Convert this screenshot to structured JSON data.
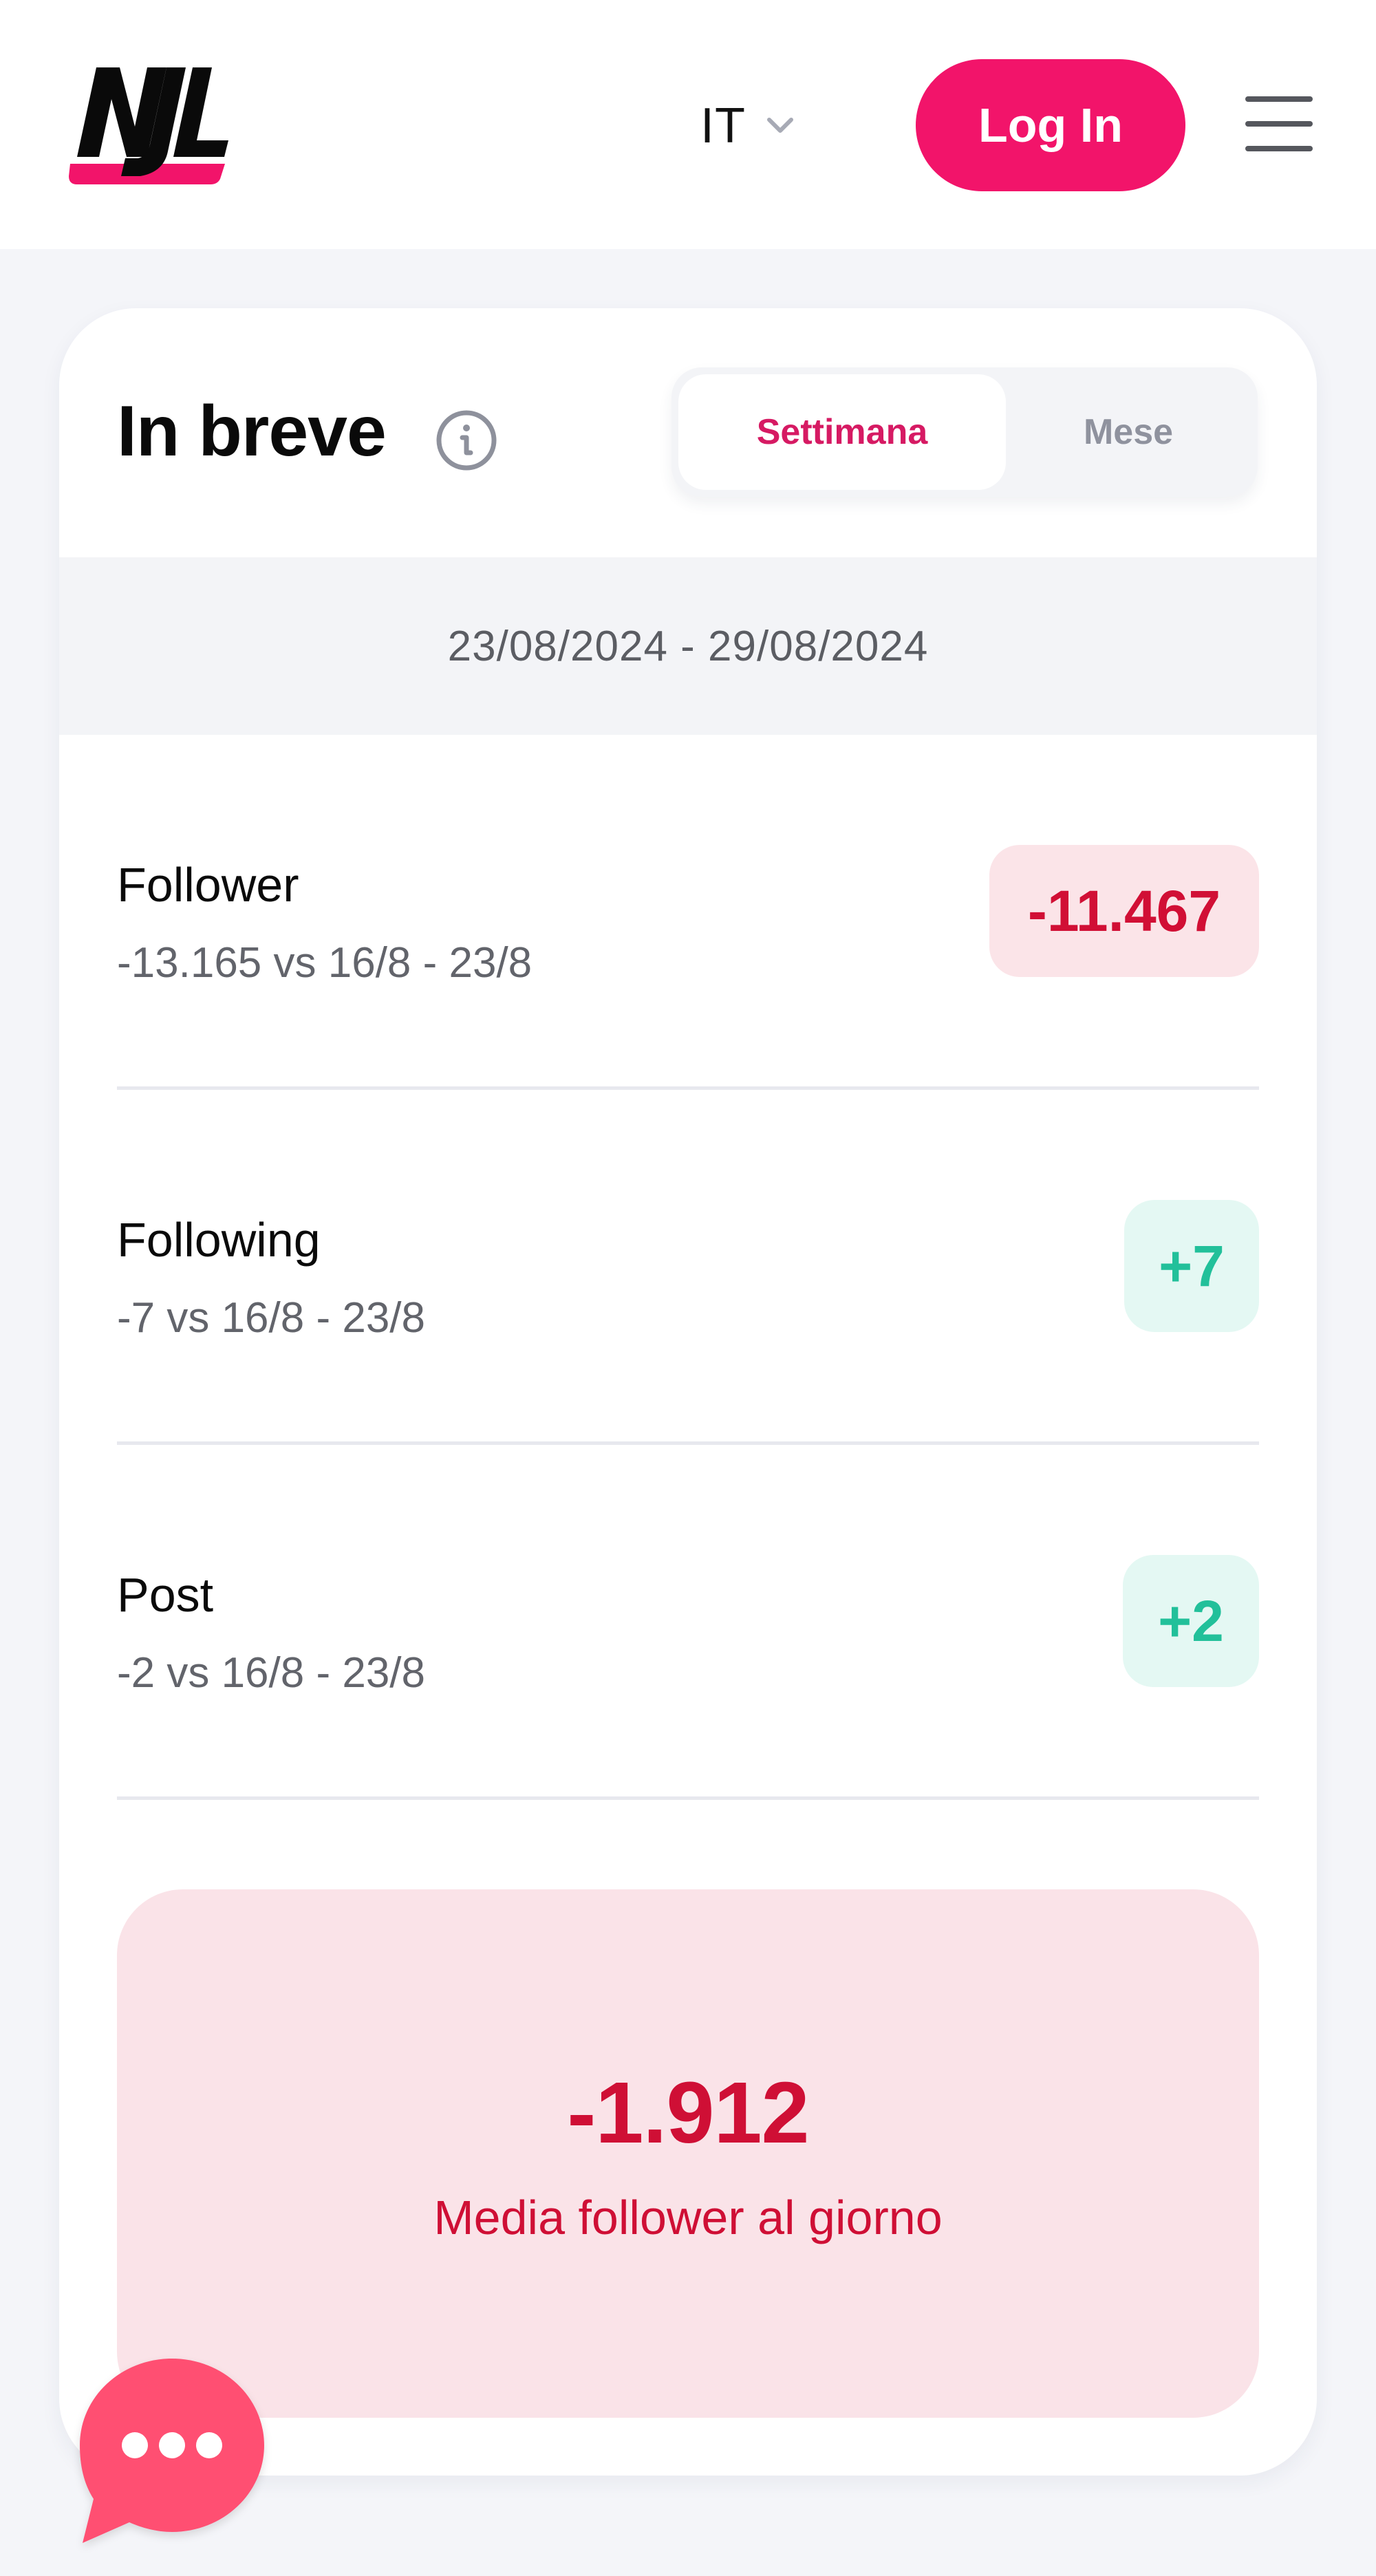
{
  "header": {
    "logo_text": "NJL",
    "language": {
      "selected": "IT",
      "icon": "chevron-down-icon"
    },
    "login_label": "Log In",
    "menu_icon": "hamburger-menu-icon"
  },
  "colors": {
    "brand_pink": "#f2146a",
    "negative": "#d10f35",
    "negative_bg": "#fbe4e8",
    "positive": "#22c09a",
    "positive_bg": "#e4f8f3",
    "chat_bubble": "#ff4f72"
  },
  "summary": {
    "title": "In breve",
    "info_icon": "info-icon",
    "period_tabs": [
      {
        "label": "Settimana",
        "active": true
      },
      {
        "label": "Mese",
        "active": false
      }
    ],
    "date_range": "23/08/2024 - 29/08/2024",
    "stats": [
      {
        "label": "Follower",
        "comparison": "-13.165 vs 16/8 - 23/8",
        "value": "-11.467",
        "trend": "negative"
      },
      {
        "label": "Following",
        "comparison": "-7 vs 16/8 - 23/8",
        "value": "+7",
        "trend": "positive"
      },
      {
        "label": "Post",
        "comparison": "-2 vs 16/8 - 23/8",
        "value": "+2",
        "trend": "positive"
      }
    ],
    "daily_average": {
      "value": "-1.912",
      "label": "Media follower al giorno"
    }
  },
  "chat": {
    "icon": "chat-bubble-icon"
  }
}
